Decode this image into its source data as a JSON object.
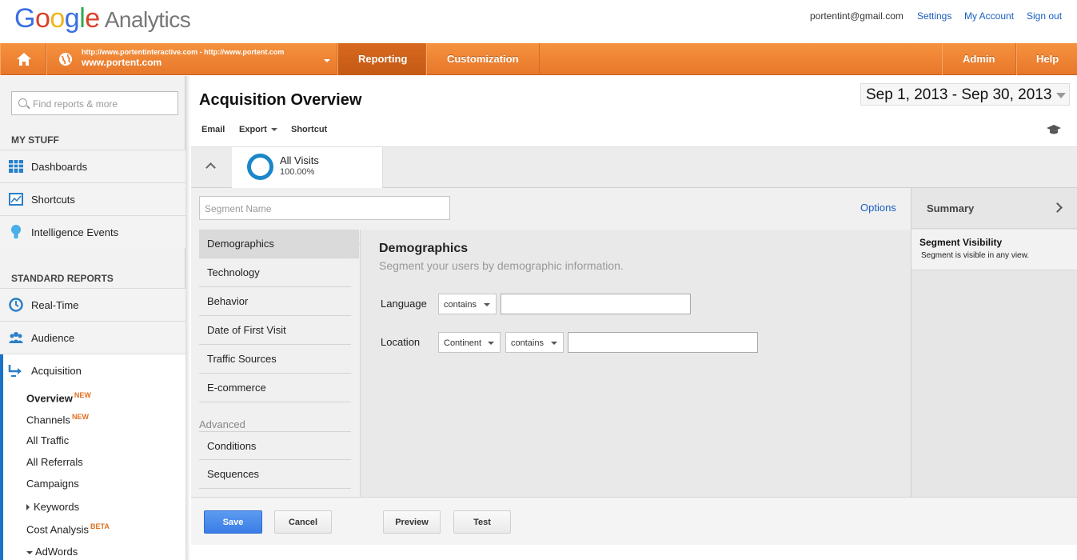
{
  "header": {
    "logo_letters": [
      "G",
      "o",
      "o",
      "g",
      "l",
      "e"
    ],
    "logo_product": "Analytics",
    "email": "portentint@gmail.com",
    "links": [
      "Settings",
      "My Account",
      "Sign out"
    ]
  },
  "nav": {
    "property_url": "http://www.portentinteractive.com - http://www.portent.com",
    "property_name": "www.portent.com",
    "tabs": [
      "Reporting",
      "Customization"
    ],
    "right_tabs": [
      "Admin",
      "Help"
    ],
    "active_tab": "Reporting",
    "brand_color": "#f08a36"
  },
  "sidebar": {
    "search_placeholder": "Find reports & more",
    "my_stuff_title": "MY STUFF",
    "my_stuff": [
      {
        "label": "Dashboards",
        "icon": "dashboards-icon"
      },
      {
        "label": "Shortcuts",
        "icon": "shortcuts-icon"
      },
      {
        "label": "Intelligence Events",
        "icon": "lightbulb-icon"
      }
    ],
    "standard_title": "STANDARD REPORTS",
    "standard": [
      {
        "label": "Real-Time",
        "icon": "realtime-icon"
      },
      {
        "label": "Audience",
        "icon": "audience-icon"
      },
      {
        "label": "Acquisition",
        "icon": "acquisition-icon"
      }
    ],
    "acquisition_sub": [
      {
        "label": "Overview",
        "badge": "NEW",
        "selected": true
      },
      {
        "label": "Channels",
        "badge": "NEW"
      },
      {
        "label": "All Traffic"
      },
      {
        "label": "All Referrals"
      },
      {
        "label": "Campaigns"
      },
      {
        "label": "Keywords",
        "arrow": "right"
      },
      {
        "label": "Cost Analysis",
        "badge": "BETA"
      },
      {
        "label": "AdWords",
        "arrow": "down"
      }
    ]
  },
  "main": {
    "title": "Acquisition Overview",
    "date_range": "Sep 1, 2013 - Sep 30, 2013",
    "toolbar": {
      "email": "Email",
      "export": "Export",
      "shortcut": "Shortcut"
    },
    "segment": {
      "name": "All Visits",
      "percent": "100.00%"
    }
  },
  "editor": {
    "segment_name_placeholder": "Segment Name",
    "options": "Options",
    "categories": [
      "Demographics",
      "Technology",
      "Behavior",
      "Date of First Visit",
      "Traffic Sources",
      "E-commerce"
    ],
    "advanced_title": "Advanced",
    "advanced": [
      "Conditions",
      "Sequences"
    ],
    "panel_title": "Demographics",
    "panel_subtitle": "Segment your users by demographic information.",
    "language_label": "Language",
    "language_op": "contains",
    "location_label": "Location",
    "location_scope": "Continent",
    "location_op": "contains"
  },
  "summary": {
    "title": "Summary",
    "visibility_title": "Segment Visibility",
    "visibility_desc": "Segment is visible in any view."
  },
  "footer": {
    "save": "Save",
    "cancel": "Cancel",
    "preview": "Preview",
    "test": "Test"
  }
}
